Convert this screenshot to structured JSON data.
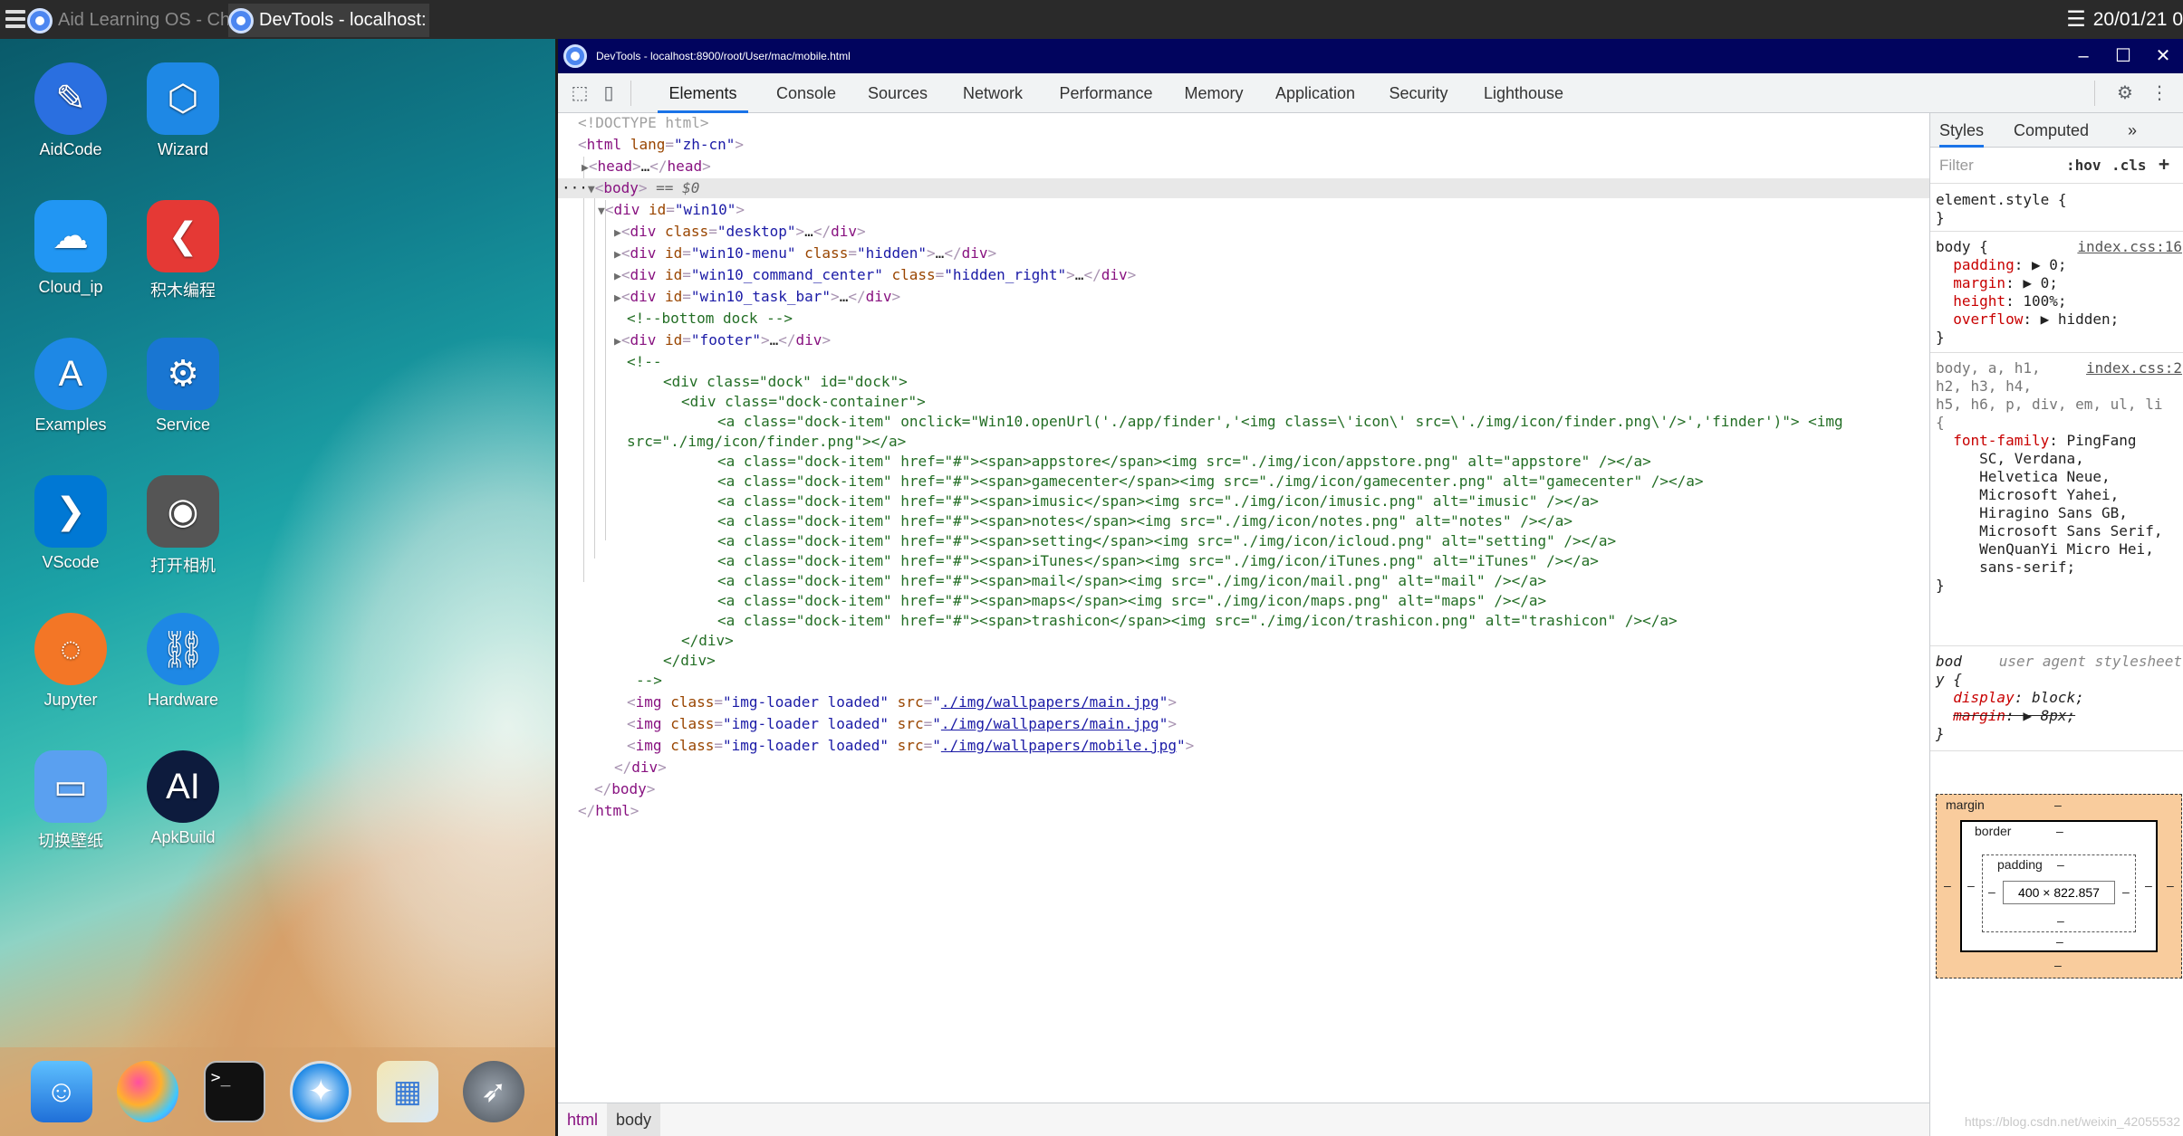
{
  "os_bar": {
    "task1_title": "Aid Learning OS - Chr",
    "task2_title": "DevTools - localhost:",
    "clock": "20/01/21 0"
  },
  "desktop": {
    "icons": [
      {
        "label": "AidCode",
        "icon": "aidcode-icon",
        "color": "#2a6fe0"
      },
      {
        "label": "Wizard",
        "icon": "wizard-cubes-icon",
        "color": "#1e88e5"
      },
      {
        "label": "Cloud_ip",
        "icon": "cloud-icon",
        "color": "#2196f3"
      },
      {
        "label": "积木编程",
        "icon": "blocks-chevron-icon",
        "color": "#e53935"
      },
      {
        "label": "Examples",
        "icon": "appstore-icon",
        "color": "#1e88e5"
      },
      {
        "label": "Service",
        "icon": "gears-icon",
        "color": "#1976d2"
      },
      {
        "label": "VScode",
        "icon": "vscode-icon",
        "color": "#0078d4"
      },
      {
        "label": "打开相机",
        "icon": "camera-icon",
        "color": "#555555"
      },
      {
        "label": "Jupyter",
        "icon": "jupyter-icon",
        "color": "#f37626"
      },
      {
        "label": "Hardware",
        "icon": "link-icon",
        "color": "#1e88e5"
      },
      {
        "label": "切换壁纸",
        "icon": "wallpaper-icon",
        "color": "#5aa0f0"
      },
      {
        "label": "ApkBuild",
        "icon": "ai-bulb-icon",
        "color": "#0d1b3d"
      }
    ],
    "dock": [
      "finder-icon",
      "gamecenter-icon",
      "terminal-icon",
      "safari-icon",
      "preview-icon",
      "launchpad-icon"
    ]
  },
  "devtools": {
    "window_title": "DevTools - localhost:8900/root/User/mac/mobile.html",
    "tabs": [
      "Elements",
      "Console",
      "Sources",
      "Network",
      "Performance",
      "Memory",
      "Application",
      "Security",
      "Lighthouse"
    ],
    "active_tab": "Elements",
    "breadcrumbs": [
      "html",
      "body"
    ],
    "sidebar": {
      "tabs": [
        "Styles",
        "Computed"
      ],
      "filter_placeholder": "Filter",
      "hov": ":hov",
      "cls": ".cls",
      "body_src": "index.css:16",
      "reset_src": "index.css:2",
      "user_agent": "user agent stylesheet",
      "box_model": {
        "margin_label": "margin",
        "border_label": "border",
        "padding_label": "padding",
        "content": "400 × 822.857",
        "dash": "–"
      }
    }
  },
  "watermark": "https://blog.csdn.net/weixin_42055532"
}
